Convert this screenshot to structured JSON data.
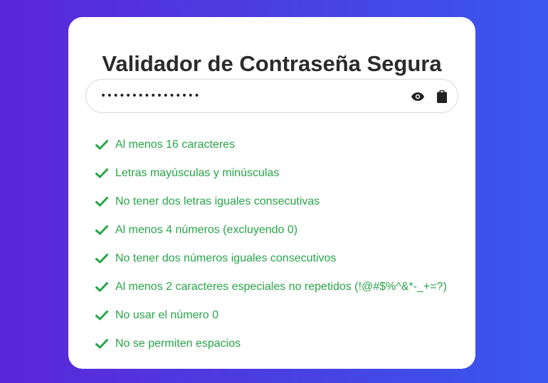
{
  "title": "Validador de Contraseña Segura",
  "password": {
    "masked_value": "••••••••••••••••"
  },
  "icons": {
    "toggle_visibility": "eye-icon",
    "copy": "clipboard-icon",
    "rule_status": "check-icon"
  },
  "colors": {
    "success": "#28a548",
    "title": "#2b2b2b",
    "gradient_start": "#5b26d9",
    "gradient_end": "#3a57ee"
  },
  "rules": [
    {
      "label": "Al menos 16 caracteres",
      "passed": true
    },
    {
      "label": "Letras mayúsculas y minúsculas",
      "passed": true
    },
    {
      "label": "No tener dos letras iguales consecutivas",
      "passed": true
    },
    {
      "label": "Al menos 4 números (excluyendo 0)",
      "passed": true
    },
    {
      "label": "No tener dos números iguales consecutivos",
      "passed": true
    },
    {
      "label": "Al menos 2 caracteres especiales no repetidos (!@#$%^&*-_+=?)",
      "passed": true
    },
    {
      "label": "No usar el número 0",
      "passed": true
    },
    {
      "label": "No se permiten espacios",
      "passed": true
    }
  ]
}
